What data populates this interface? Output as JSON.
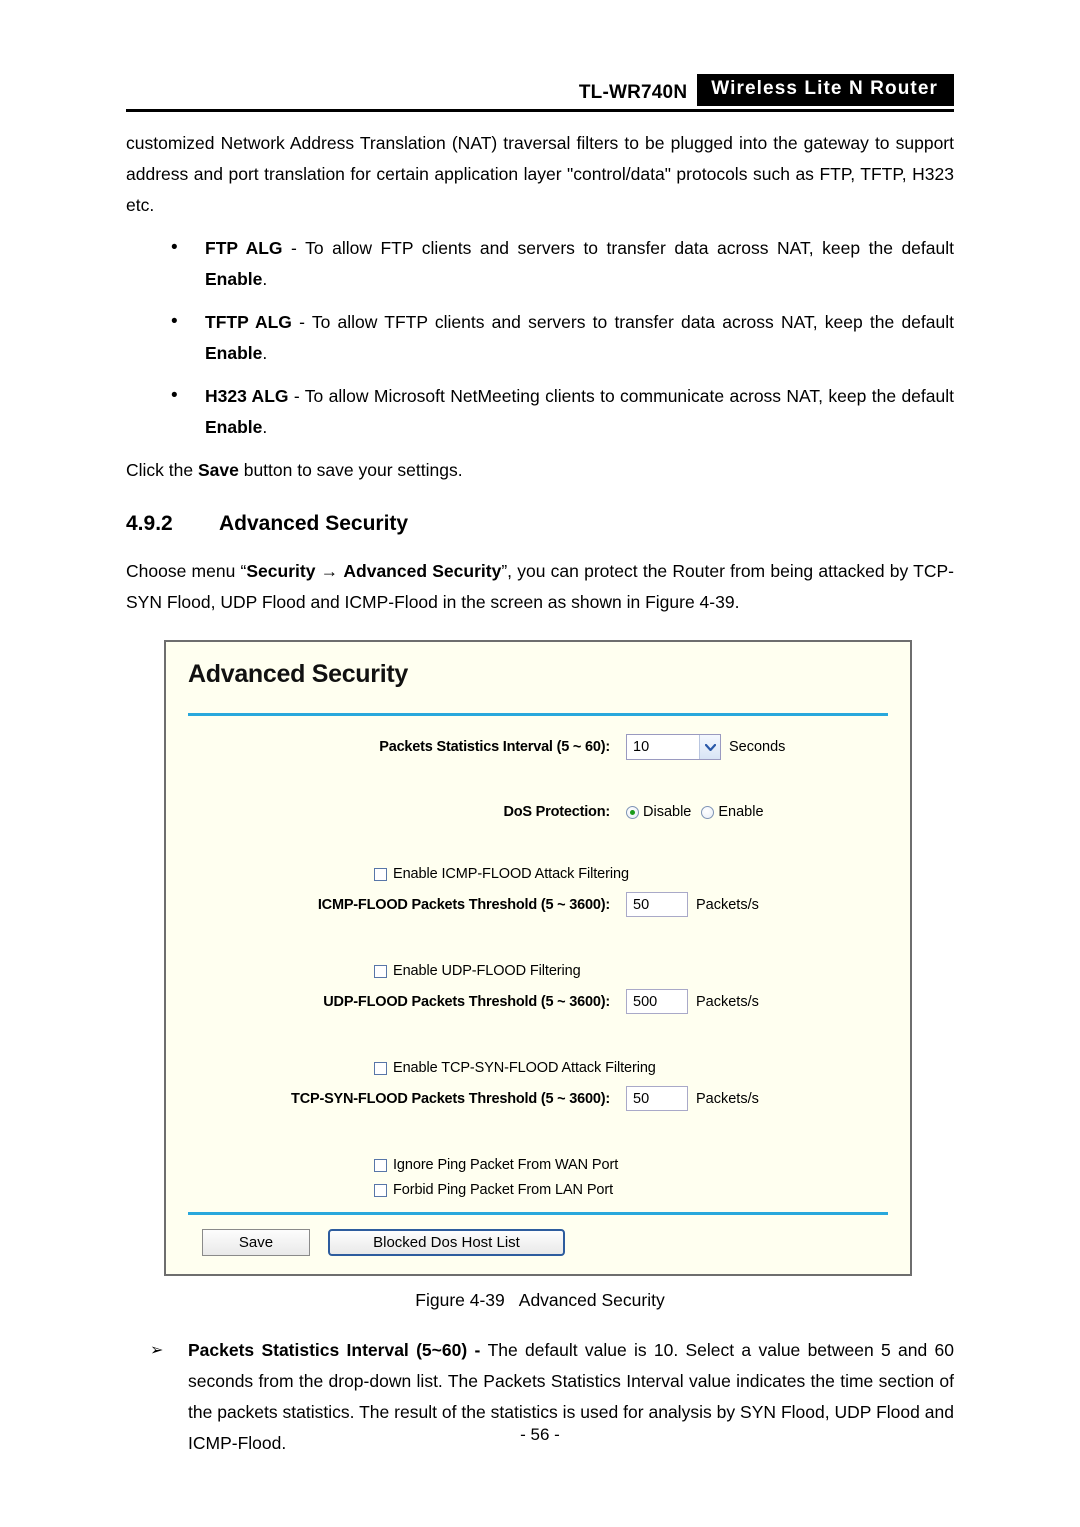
{
  "header": {
    "model": "TL-WR740N",
    "product_tag": "Wireless Lite N Router"
  },
  "body_text": {
    "intro_paragraph": "customized Network Address Translation (NAT) traversal filters to be plugged into the gateway to support address and port translation for certain application layer \"control/data\" protocols such as FTP, TFTP, H323 etc.",
    "bullets": [
      {
        "term": "FTP ALG",
        "dash": " - ",
        "text_before": "To allow FTP clients and servers to transfer data across NAT, keep the default ",
        "emphasis": "Enable",
        "text_after": "."
      },
      {
        "term": "TFTP ALG",
        "dash": " - ",
        "text_before": "To allow TFTP clients and servers to transfer data across NAT, keep the default ",
        "emphasis": "Enable",
        "text_after": "."
      },
      {
        "term": "H323 ALG",
        "dash": " - ",
        "text_before": "To allow Microsoft NetMeeting clients to communicate across NAT, keep the default ",
        "emphasis": "Enable",
        "text_after": "."
      }
    ],
    "click_save_before": "Click the ",
    "click_save_bold": "Save",
    "click_save_after": " button to save your settings.",
    "section_number": "4.9.2",
    "section_title": "Advanced Security",
    "choose_menu_1": "Choose menu “",
    "choose_menu_bold1": "Security",
    "choose_menu_arrow": " → ",
    "choose_menu_bold2": "Advanced Security",
    "choose_menu_2": "”, you can protect the Router from being attacked by TCP-SYN Flood, UDP Flood and ICMP-Flood in the screen as shown in Figure 4-39."
  },
  "router_ui": {
    "panel_title": "Advanced Security",
    "packets_interval_label": "Packets Statistics Interval (5 ~ 60):",
    "packets_interval_value": "10",
    "packets_interval_unit": "Seconds",
    "dos_protection_label": "DoS Protection:",
    "dos_disable_label": "Disable",
    "dos_enable_label": "Enable",
    "dos_selected": "Disable",
    "icmp_checkbox_label": "Enable ICMP-FLOOD Attack Filtering",
    "icmp_threshold_label": "ICMP-FLOOD Packets Threshold (5 ~ 3600):",
    "icmp_threshold_value": "50",
    "icmp_threshold_unit": "Packets/s",
    "udp_checkbox_label": "Enable UDP-FLOOD Filtering",
    "udp_threshold_label": "UDP-FLOOD Packets Threshold (5 ~ 3600):",
    "udp_threshold_value": "500",
    "udp_threshold_unit": "Packets/s",
    "tcp_checkbox_label": "Enable TCP-SYN-FLOOD Attack Filtering",
    "tcp_threshold_label": "TCP-SYN-FLOOD Packets Threshold (5 ~ 3600):",
    "tcp_threshold_value": "50",
    "tcp_threshold_unit": "Packets/s",
    "ignore_ping_wan_label": "Ignore Ping Packet From WAN Port",
    "forbid_ping_lan_label": "Forbid Ping Packet From LAN Port",
    "save_button": "Save",
    "blocked_host_button": "Blocked Dos Host List",
    "colors": {
      "panel_background": "#FFFFF0",
      "divider": "#29A8DC",
      "panel_border": "#6E6E6E",
      "radio_selected": "#1A9B1A",
      "focus_border": "#2D5C9E"
    }
  },
  "figure": {
    "number": "Figure 4-39",
    "title": "Advanced Security"
  },
  "description": {
    "term": "Packets Statistics Interval (5~60)",
    "dash": " - ",
    "text": "The default value is 10. Select a value between 5 and 60 seconds from the drop-down list. The Packets Statistics Interval value indicates the time section of the packets statistics. The result of the statistics is used for analysis by SYN Flood, UDP Flood and ICMP-Flood."
  },
  "footer": {
    "page_number": "- 56 -"
  }
}
